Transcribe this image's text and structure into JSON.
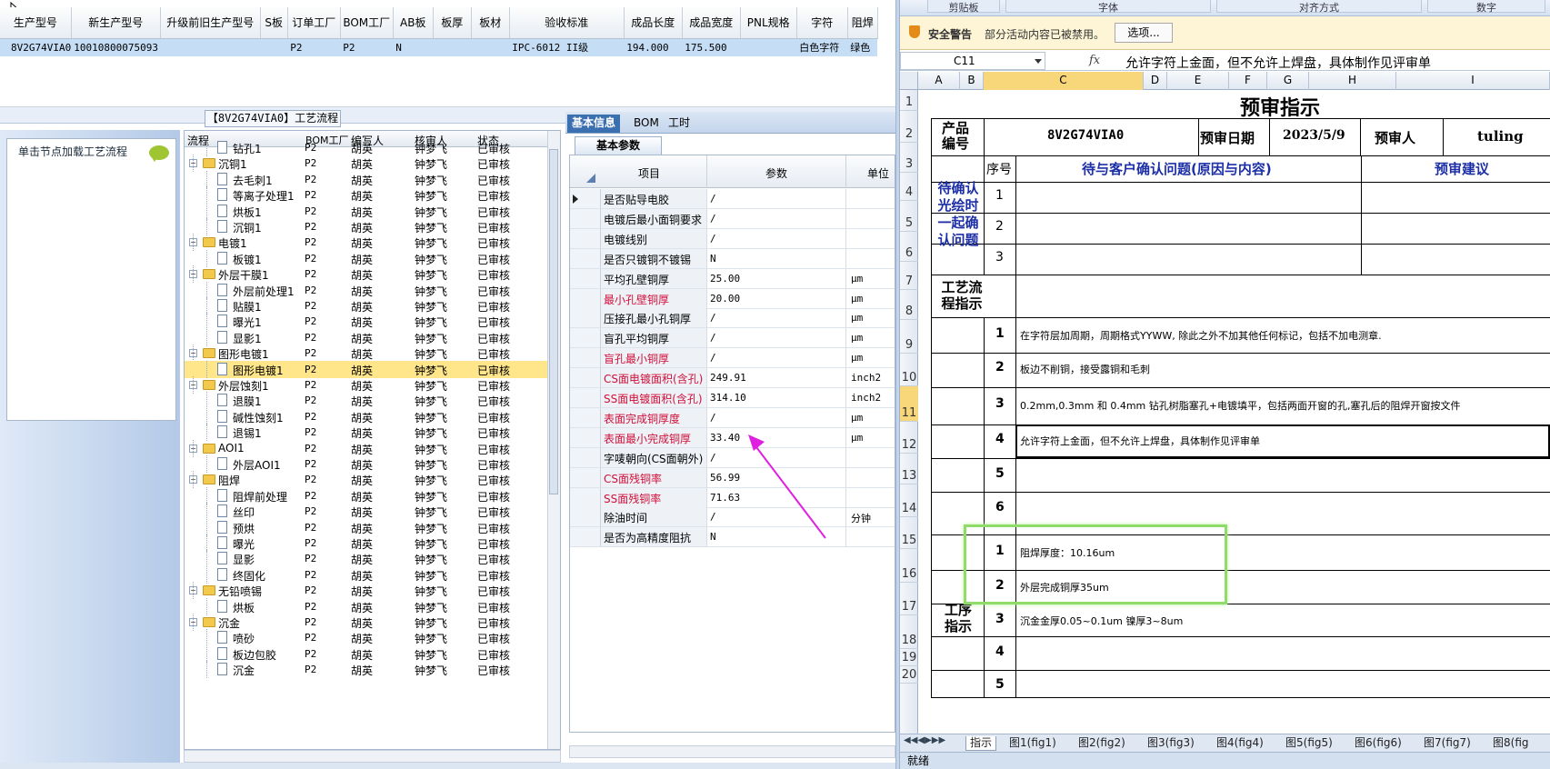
{
  "top_grid": {
    "headers": [
      "生产型号",
      "新生产型号",
      "升级前旧生产型号",
      "S板",
      "订单工厂",
      "BOM工厂",
      "AB板",
      "板厚",
      "板材",
      "验收标准",
      "成品长度",
      "成品宽度",
      "PNL规格",
      "字符",
      "阻焊"
    ],
    "row": [
      "8V2G74VIA0",
      "10010800075093",
      "",
      "",
      "P2",
      "P2",
      "N",
      "",
      "",
      "IPC-6012 II级",
      "194.000",
      "175.500",
      "",
      "白色字符",
      "绿色"
    ]
  },
  "flow": {
    "title": "【8V2G74VIA0】工艺流程",
    "load_hint": "单击节点加载工艺流程"
  },
  "tree": {
    "headers": [
      "流程",
      "BOM工厂",
      "编写人",
      "核审人",
      "状态"
    ],
    "rows": [
      {
        "lvl": 1,
        "name": "钻孔1",
        "f": "P2",
        "a": "胡英",
        "b": "钟梦飞",
        "s": "已审核",
        "type": "doc"
      },
      {
        "lvl": 0,
        "name": "沉铜1",
        "f": "P2",
        "a": "胡英",
        "b": "钟梦飞",
        "s": "已审核",
        "type": "folder"
      },
      {
        "lvl": 1,
        "name": "去毛刺1",
        "f": "P2",
        "a": "胡英",
        "b": "钟梦飞",
        "s": "已审核",
        "type": "doc"
      },
      {
        "lvl": 1,
        "name": "等离子处理1",
        "f": "P2",
        "a": "胡英",
        "b": "钟梦飞",
        "s": "已审核",
        "type": "doc"
      },
      {
        "lvl": 1,
        "name": "烘板1",
        "f": "P2",
        "a": "胡英",
        "b": "钟梦飞",
        "s": "已审核",
        "type": "doc"
      },
      {
        "lvl": 1,
        "name": "沉铜1",
        "f": "P2",
        "a": "胡英",
        "b": "钟梦飞",
        "s": "已审核",
        "type": "doc"
      },
      {
        "lvl": 0,
        "name": "电镀1",
        "f": "P2",
        "a": "胡英",
        "b": "钟梦飞",
        "s": "已审核",
        "type": "folder"
      },
      {
        "lvl": 1,
        "name": "板镀1",
        "f": "P2",
        "a": "胡英",
        "b": "钟梦飞",
        "s": "已审核",
        "type": "doc"
      },
      {
        "lvl": 0,
        "name": "外层干膜1",
        "f": "P2",
        "a": "胡英",
        "b": "钟梦飞",
        "s": "已审核",
        "type": "folder"
      },
      {
        "lvl": 1,
        "name": "外层前处理1",
        "f": "P2",
        "a": "胡英",
        "b": "钟梦飞",
        "s": "已审核",
        "type": "doc"
      },
      {
        "lvl": 1,
        "name": "贴膜1",
        "f": "P2",
        "a": "胡英",
        "b": "钟梦飞",
        "s": "已审核",
        "type": "doc"
      },
      {
        "lvl": 1,
        "name": "曝光1",
        "f": "P2",
        "a": "胡英",
        "b": "钟梦飞",
        "s": "已审核",
        "type": "doc"
      },
      {
        "lvl": 1,
        "name": "显影1",
        "f": "P2",
        "a": "胡英",
        "b": "钟梦飞",
        "s": "已审核",
        "type": "doc"
      },
      {
        "lvl": 0,
        "name": "图形电镀1",
        "f": "P2",
        "a": "胡英",
        "b": "钟梦飞",
        "s": "已审核",
        "type": "folder"
      },
      {
        "lvl": 1,
        "name": "图形电镀1",
        "f": "P2",
        "a": "胡英",
        "b": "钟梦飞",
        "s": "已审核",
        "type": "doc",
        "sel": true
      },
      {
        "lvl": 0,
        "name": "外层蚀刻1",
        "f": "P2",
        "a": "胡英",
        "b": "钟梦飞",
        "s": "已审核",
        "type": "folder"
      },
      {
        "lvl": 1,
        "name": "退膜1",
        "f": "P2",
        "a": "胡英",
        "b": "钟梦飞",
        "s": "已审核",
        "type": "doc"
      },
      {
        "lvl": 1,
        "name": "碱性蚀刻1",
        "f": "P2",
        "a": "胡英",
        "b": "钟梦飞",
        "s": "已审核",
        "type": "doc"
      },
      {
        "lvl": 1,
        "name": "退锡1",
        "f": "P2",
        "a": "胡英",
        "b": "钟梦飞",
        "s": "已审核",
        "type": "doc"
      },
      {
        "lvl": 0,
        "name": "AOI1",
        "f": "P2",
        "a": "胡英",
        "b": "钟梦飞",
        "s": "已审核",
        "type": "folder"
      },
      {
        "lvl": 1,
        "name": "外层AOI1",
        "f": "P2",
        "a": "胡英",
        "b": "钟梦飞",
        "s": "已审核",
        "type": "doc"
      },
      {
        "lvl": 0,
        "name": "阻焊",
        "f": "P2",
        "a": "胡英",
        "b": "钟梦飞",
        "s": "已审核",
        "type": "folder"
      },
      {
        "lvl": 1,
        "name": "阻焊前处理",
        "f": "P2",
        "a": "胡英",
        "b": "钟梦飞",
        "s": "已审核",
        "type": "doc"
      },
      {
        "lvl": 1,
        "name": "丝印",
        "f": "P2",
        "a": "胡英",
        "b": "钟梦飞",
        "s": "已审核",
        "type": "doc"
      },
      {
        "lvl": 1,
        "name": "预烘",
        "f": "P2",
        "a": "胡英",
        "b": "钟梦飞",
        "s": "已审核",
        "type": "doc"
      },
      {
        "lvl": 1,
        "name": "曝光",
        "f": "P2",
        "a": "胡英",
        "b": "钟梦飞",
        "s": "已审核",
        "type": "doc"
      },
      {
        "lvl": 1,
        "name": "显影",
        "f": "P2",
        "a": "胡英",
        "b": "钟梦飞",
        "s": "已审核",
        "type": "doc"
      },
      {
        "lvl": 1,
        "name": "终固化",
        "f": "P2",
        "a": "胡英",
        "b": "钟梦飞",
        "s": "已审核",
        "type": "doc"
      },
      {
        "lvl": 0,
        "name": "无铅喷锡",
        "f": "P2",
        "a": "胡英",
        "b": "钟梦飞",
        "s": "已审核",
        "type": "folder"
      },
      {
        "lvl": 1,
        "name": "烘板",
        "f": "P2",
        "a": "胡英",
        "b": "钟梦飞",
        "s": "已审核",
        "type": "doc"
      },
      {
        "lvl": 0,
        "name": "沉金",
        "f": "P2",
        "a": "胡英",
        "b": "钟梦飞",
        "s": "已审核",
        "type": "folder"
      },
      {
        "lvl": 1,
        "name": "喷砂",
        "f": "P2",
        "a": "胡英",
        "b": "钟梦飞",
        "s": "已审核",
        "type": "doc"
      },
      {
        "lvl": 1,
        "name": "板边包胶",
        "f": "P2",
        "a": "胡英",
        "b": "钟梦飞",
        "s": "已审核",
        "type": "doc"
      },
      {
        "lvl": 1,
        "name": "沉金",
        "f": "P2",
        "a": "胡英",
        "b": "钟梦飞",
        "s": "已审核",
        "type": "doc"
      }
    ]
  },
  "params": {
    "tabs": [
      "基本信息",
      "BOM",
      "工时"
    ],
    "subtab": "基本参数",
    "headers": [
      "项目",
      "参数",
      "单位"
    ],
    "rows": [
      {
        "k": "是否贴导电胶",
        "v": "/",
        "u": "",
        "red": false
      },
      {
        "k": "电镀后最小面铜要求",
        "v": "/",
        "u": "",
        "red": false
      },
      {
        "k": "电镀线别",
        "v": "/",
        "u": "",
        "red": false
      },
      {
        "k": "是否只镀铜不镀锡",
        "v": "N",
        "u": "",
        "red": false
      },
      {
        "k": "平均孔壁铜厚",
        "v": "25.00",
        "u": "μm",
        "red": false
      },
      {
        "k": "最小孔壁铜厚",
        "v": "20.00",
        "u": "μm",
        "red": true
      },
      {
        "k": "压接孔最小孔铜厚",
        "v": "/",
        "u": "μm",
        "red": false
      },
      {
        "k": "盲孔平均铜厚",
        "v": "/",
        "u": "μm",
        "red": false
      },
      {
        "k": "盲孔最小铜厚",
        "v": "/",
        "u": "μm",
        "red": true
      },
      {
        "k": "CS面电镀面积(含孔)",
        "v": "249.91",
        "u": "inch2",
        "red": true
      },
      {
        "k": "SS面电镀面积(含孔)",
        "v": "314.10",
        "u": "inch2",
        "red": true
      },
      {
        "k": "表面完成铜厚度",
        "v": "/",
        "u": "μm",
        "red": true
      },
      {
        "k": "表面最小完成铜厚",
        "v": "33.40",
        "u": "μm",
        "red": true
      },
      {
        "k": "字唛朝向(CS面朝外)",
        "v": "/",
        "u": "",
        "red": false
      },
      {
        "k": "CS面残铜率",
        "v": "56.99",
        "u": "",
        "red": true
      },
      {
        "k": "SS面残铜率",
        "v": "71.63",
        "u": "",
        "red": true
      },
      {
        "k": "除油时间",
        "v": "/",
        "u": "分钟",
        "red": false
      },
      {
        "k": "是否为高精度阻抗",
        "v": "N",
        "u": "",
        "red": false
      }
    ]
  },
  "excel": {
    "ribbon": [
      "剪贴板",
      "字体",
      "对齐方式",
      "数字"
    ],
    "security_warning": "安全警告",
    "security_message": "部分活动内容已被禁用。",
    "options_button": "选项...",
    "name_box": "C11",
    "fx": "fx",
    "formula": "允许字符上金面，但不允许上焊盘，具体制作见评审单",
    "columns": [
      "A",
      "B",
      "C",
      "D",
      "E",
      "F",
      "G",
      "H",
      "I"
    ],
    "rows": [
      "1",
      "2",
      "3",
      "4",
      "5",
      "6",
      "7",
      "8",
      "9",
      "10",
      "11",
      "12",
      "13",
      "14",
      "15",
      "16",
      "17",
      "18",
      "19",
      "20"
    ],
    "title": "预审指示",
    "product_no_label": "产品编号",
    "product_no": "8V2G74VIA0",
    "review_date_label": "预审日期",
    "review_date": "2023/5/9",
    "reviewer_label": "预审人",
    "reviewer": "tuling",
    "seq_label": "序号",
    "issue_header": "待与客户确认问题(原因与内容)",
    "suggest_header": "预审建议",
    "confirm_label": "待确认光绘时一起确认问题",
    "confirm_nums": [
      "1",
      "2",
      "3"
    ],
    "flow_label": "工艺流程指示",
    "flow_items": [
      {
        "n": "1",
        "t": "在字符层加周期，周期格式YYWW, 除此之外不加其他任何标记，包括不加电测章."
      },
      {
        "n": "2",
        "t": "板边不削铜，接受露铜和毛刺"
      },
      {
        "n": "3",
        "t": "0.2mm,0.3mm 和 0.4mm 钻孔树脂塞孔+电镀填平，包括两面开窗的孔,塞孔后的阻焊开窗按文件"
      },
      {
        "n": "4",
        "t": "允许字符上金面，但不允许上焊盘，具体制作见评审单"
      },
      {
        "n": "5",
        "t": ""
      },
      {
        "n": "6",
        "t": ""
      }
    ],
    "proc_label": "工序指示",
    "proc_items": [
      {
        "n": "1",
        "t": "阻焊厚度：10.16um"
      },
      {
        "n": "2",
        "t": "外层完成铜厚35um"
      },
      {
        "n": "3",
        "t": "沉金金厚0.05~0.1um 镍厚3~8um"
      },
      {
        "n": "4",
        "t": ""
      },
      {
        "n": "5",
        "t": ""
      }
    ],
    "sheet_tabs": [
      "指示",
      "图1(fig1)",
      "图2(fig2)",
      "图3(fig3)",
      "图4(fig4)",
      "图5(fig5)",
      "图6(fig6)",
      "图7(fig7)",
      "图8(fig"
    ],
    "status": "就绪"
  },
  "colors": {
    "selection": "#c5ddf5",
    "tree_selected": "#ffe68a",
    "annotation_arrow": "#e020e0",
    "highlight_box": "#8fdc6a",
    "blue_text": "#1c2fa6"
  }
}
